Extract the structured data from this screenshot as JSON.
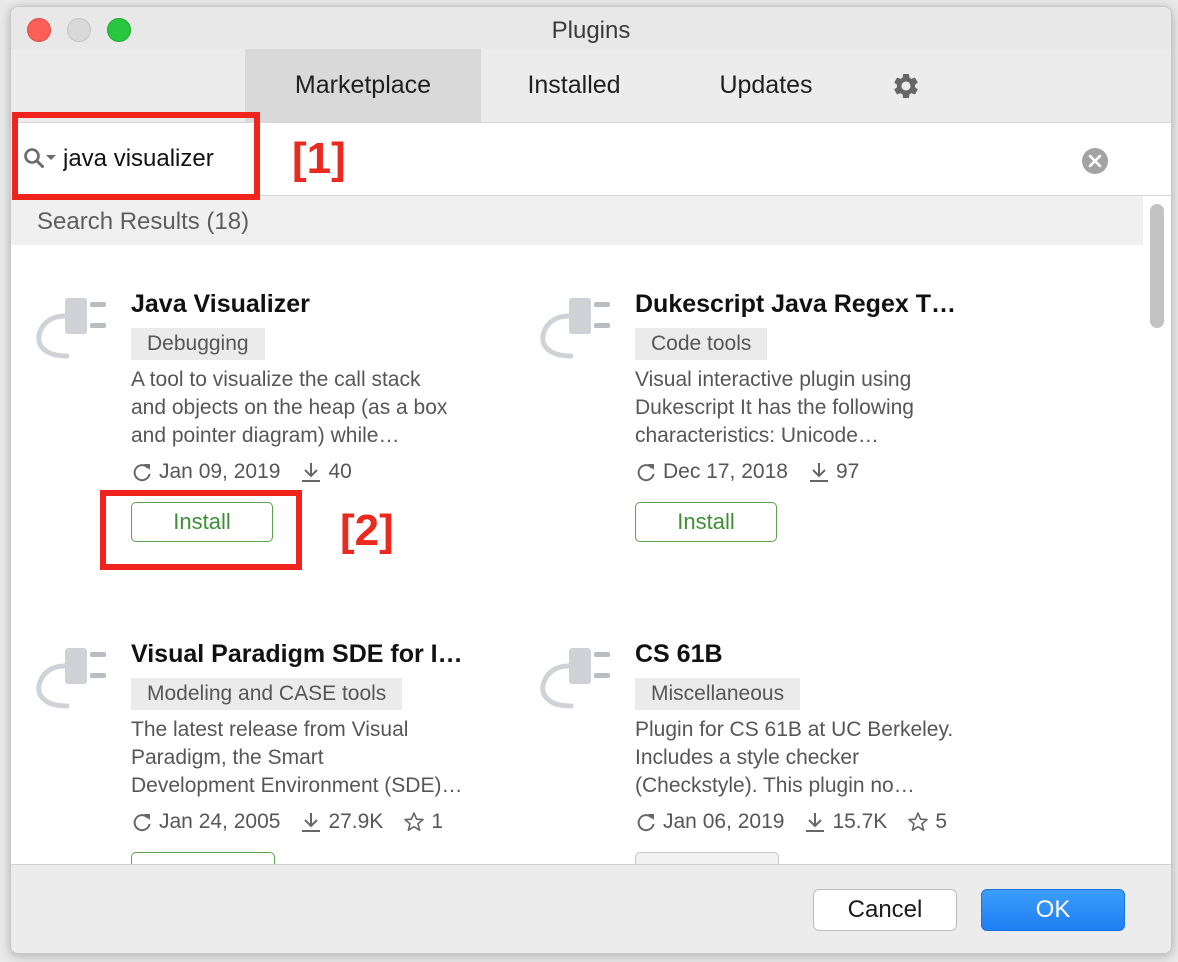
{
  "window": {
    "title": "Plugins"
  },
  "tabs": {
    "marketplace": "Marketplace",
    "installed": "Installed",
    "updates": "Updates",
    "settings_icon": "gear-icon"
  },
  "search": {
    "value": "java visualizer",
    "placeholder": ""
  },
  "annotations": {
    "search": "[1]",
    "install": "[2]"
  },
  "results": {
    "header": "Search Results (18)"
  },
  "plugins": [
    {
      "name": "Java Visualizer",
      "tag": "Debugging",
      "description": [
        "A tool to visualize the call stack",
        "and objects on the heap (as a box",
        "and pointer diagram) while…"
      ],
      "date": "Jan 09, 2019",
      "downloads": "40",
      "rating": "",
      "button": "Install"
    },
    {
      "name": "Dukescript Java Regex T…",
      "tag": "Code tools",
      "description": [
        "Visual interactive plugin using",
        "Dukescript It has the following",
        "characteristics: Unicode…"
      ],
      "date": "Dec 17, 2018",
      "downloads": "97",
      "rating": "",
      "button": "Install"
    },
    {
      "name": "Visual Paradigm SDE for I…",
      "tag": "Modeling and CASE tools",
      "description": [
        "The latest release from Visual",
        "Paradigm, the Smart",
        "Development Environment (SDE)…"
      ],
      "date": "Jan 24, 2005",
      "downloads": "27.9K",
      "rating": "1"
    },
    {
      "name": "CS 61B",
      "tag": "Miscellaneous",
      "description": [
        "Plugin for CS 61B at UC Berkeley.",
        "Includes a style checker",
        "(Checkstyle). This plugin no…"
      ],
      "date": "Jan 06, 2019",
      "downloads": "15.7K",
      "rating": "5"
    }
  ],
  "footer": {
    "cancel": "Cancel",
    "ok": "OK"
  },
  "colors": {
    "accent": "#1d7ff3",
    "install_green": "#3f8f35",
    "annotation_red": "#f0241c"
  }
}
